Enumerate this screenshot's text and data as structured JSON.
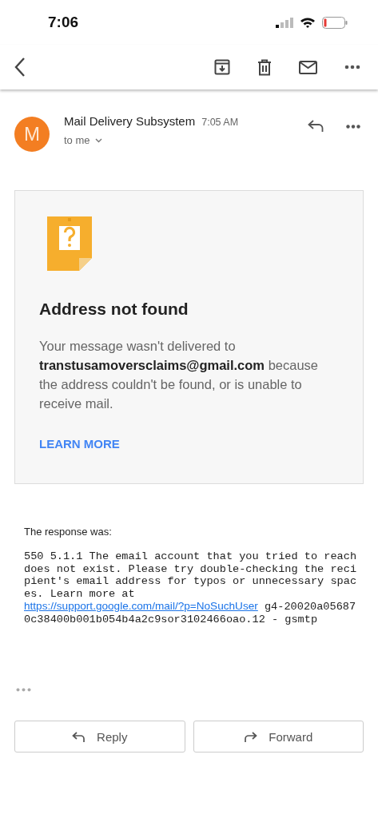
{
  "status_bar": {
    "time": "7:06"
  },
  "message": {
    "sender": "Mail Delivery Subsystem",
    "avatar_letter": "M",
    "time": "7:05 AM",
    "recipient": "to me"
  },
  "notice": {
    "title": "Address not found",
    "text_before": "Your message wasn't delivered to ",
    "address": "transtusamoversclaims@gmail.com",
    "text_after": " because the address couldn't be found, or is unable to receive mail.",
    "link": "LEARN MORE"
  },
  "response": {
    "label": "The response was:",
    "text_before": "550 5.1.1 The email account that you tried to reach does not exist. Please try double-checking the recipient's email address for typos or unnecessary spaces. Learn more at ",
    "link": "https://support.google.com/mail/?p=NoSuchUser",
    "text_after": " g4-20020a056870c38400b001b054b4a2c9sor3102466oao.12 - gsmtp"
  },
  "actions": [
    "Reply",
    "Forward"
  ]
}
